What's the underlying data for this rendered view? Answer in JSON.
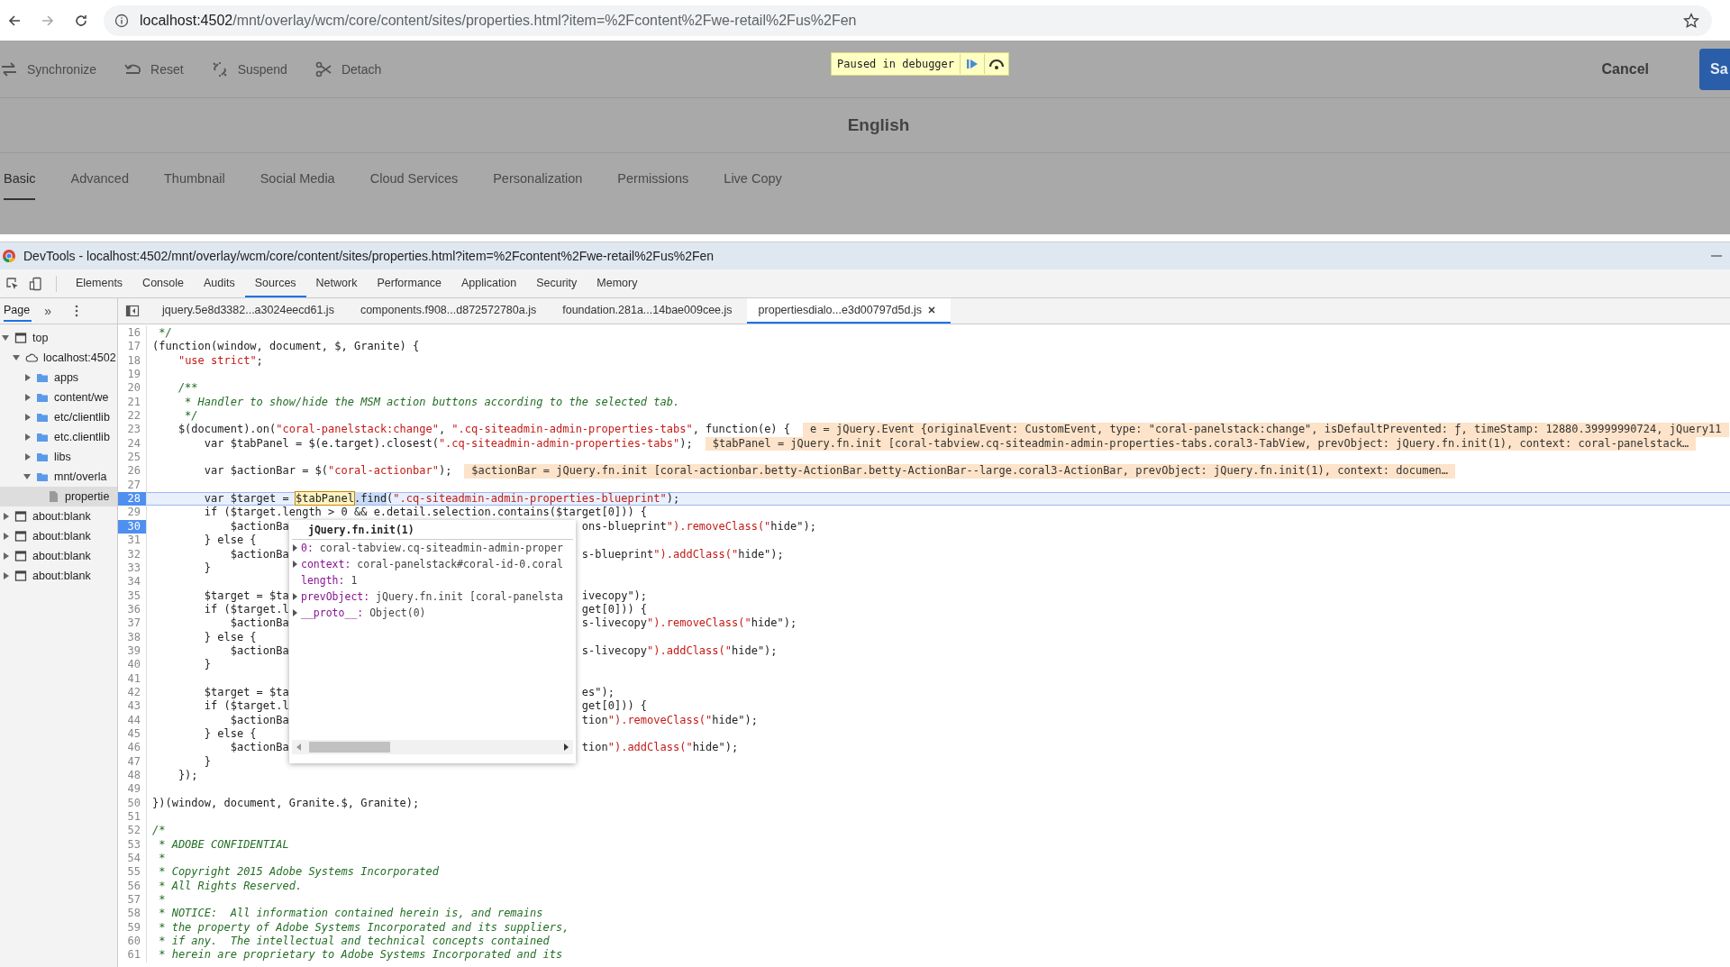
{
  "browser": {
    "url_host": "localhost:4502",
    "url_path": "/mnt/overlay/wcm/core/content/sites/properties.html?item=%2Fcontent%2Fwe-retail%2Fus%2Fen"
  },
  "aem": {
    "actions": [
      {
        "label": "Synchronize",
        "kind": "sync"
      },
      {
        "label": "Reset",
        "kind": "reset"
      },
      {
        "label": "Suspend",
        "kind": "suspend"
      },
      {
        "label": "Detach",
        "kind": "detach"
      }
    ],
    "paused_label": "Paused in debugger",
    "cancel": "Cancel",
    "save": "Sa",
    "title": "English",
    "tabs": [
      {
        "label": "Basic",
        "selected": true
      },
      {
        "label": "Advanced",
        "selected": false
      },
      {
        "label": "Thumbnail",
        "selected": false
      },
      {
        "label": "Social Media",
        "selected": false
      },
      {
        "label": "Cloud Services",
        "selected": false
      },
      {
        "label": "Personalization",
        "selected": false
      },
      {
        "label": "Permissions",
        "selected": false
      },
      {
        "label": "Live Copy",
        "selected": false
      }
    ]
  },
  "devtools": {
    "title": "DevTools - localhost:4502/mnt/overlay/wcm/core/content/sites/properties.html?item=%2Fcontent%2Fwe-retail%2Fus%2Fen",
    "panels": [
      {
        "label": "Elements",
        "selected": false
      },
      {
        "label": "Console",
        "selected": false
      },
      {
        "label": "Audits",
        "selected": false
      },
      {
        "label": "Sources",
        "selected": true
      },
      {
        "label": "Network",
        "selected": false
      },
      {
        "label": "Performance",
        "selected": false
      },
      {
        "label": "Application",
        "selected": false
      },
      {
        "label": "Security",
        "selected": false
      },
      {
        "label": "Memory",
        "selected": false
      }
    ],
    "navigator_tab": "Page",
    "more": "»",
    "files": [
      {
        "label": "jquery.5e8d3382...a3024eecd61.js",
        "selected": false
      },
      {
        "label": "components.f908...d872572780a.js",
        "selected": false
      },
      {
        "label": "foundation.281a...14bae009cee.js",
        "selected": false
      },
      {
        "label": "propertiesdialo...e3d00797d5d.js",
        "selected": true
      }
    ],
    "tree": [
      {
        "label": "top",
        "kind": "frame",
        "expanded": true,
        "children": [
          {
            "label": "localhost:4502",
            "kind": "origin",
            "expanded": true,
            "children": [
              {
                "label": "apps",
                "kind": "folder",
                "expanded": false
              },
              {
                "label": "content/we",
                "kind": "folder",
                "expanded": false
              },
              {
                "label": "etc/clientlib",
                "kind": "folder",
                "expanded": false
              },
              {
                "label": "etc.clientlib",
                "kind": "folder",
                "expanded": false
              },
              {
                "label": "libs",
                "kind": "folder",
                "expanded": false
              },
              {
                "label": "mnt/overla",
                "kind": "folder",
                "expanded": true,
                "children": [
                  {
                    "label": "propertie",
                    "kind": "file",
                    "selected": true
                  }
                ]
              }
            ]
          }
        ]
      },
      {
        "label": "about:blank",
        "kind": "frame",
        "expanded": false
      },
      {
        "label": "about:blank",
        "kind": "frame",
        "expanded": false
      },
      {
        "label": "about:blank",
        "kind": "frame",
        "expanded": false
      },
      {
        "label": "about:blank",
        "kind": "frame",
        "expanded": false
      }
    ],
    "lines": [
      {
        "n": "16",
        "kind": "comment",
        "parts": [
          {
            "text": " */"
          }
        ]
      },
      {
        "n": "17",
        "parts": [
          {
            "text": "(function(window, document, $, Granite) {"
          }
        ]
      },
      {
        "n": "18",
        "parts": [
          {
            "text": "    \"use strict\";"
          }
        ]
      },
      {
        "n": "19"
      },
      {
        "n": "20",
        "kind": "comment",
        "parts": [
          {
            "text": "    /**"
          }
        ]
      },
      {
        "n": "21",
        "kind": "comment",
        "parts": [
          {
            "text": "     * Handler to show/hide the MSM action buttons according to the selected tab."
          }
        ]
      },
      {
        "n": "22",
        "kind": "comment",
        "parts": [
          {
            "text": "     */"
          }
        ]
      },
      {
        "n": "23",
        "parts": [
          {
            "text": "    $(document).on(\"coral-panelstack:change\", \".cq-siteadmin-admin-properties-tabs\", function(e) {"
          }
        ],
        "inline": "e = jQuery.Event {originalEvent: CustomEvent, type: \"coral-panelstack:change\", isDefaultPrevented: ƒ, timeStamp: 12880.39999990724, jQuery11"
      },
      {
        "n": "24",
        "parts": [
          {
            "text": "        var $tabPanel = $(e.target).closest(\".cq-siteadmin-admin-properties-tabs\");"
          }
        ],
        "inline": "$tabPanel = jQuery.fn.init [coral-tabview.cq-siteadmin-admin-properties-tabs.coral3-TabView, prevObject: jQuery.fn.init(1), context: coral-panelstack…"
      },
      {
        "n": "25"
      },
      {
        "n": "26",
        "parts": [
          {
            "text": "        var $actionBar = $(\"coral-actionbar\");"
          }
        ],
        "inline": "$actionBar = jQuery.fn.init [coral-actionbar.betty-ActionBar.betty-ActionBar--large.coral3-ActionBar, prevObject: jQuery.fn.init(1), context: documen…"
      },
      {
        "n": "27"
      },
      {
        "n": "28",
        "breakpoint": true,
        "current": true,
        "parts": [
          {
            "text": "        var $target = "
          },
          {
            "text": "$tabPanel",
            "kind": "hover"
          },
          {
            "text": ".find",
            "kind": "selection"
          },
          {
            "text": "(\".cq-siteadmin-admin-properties-blueprint\");"
          }
        ]
      },
      {
        "n": "29",
        "parts": [
          {
            "text": "        if ($target.length > 0 && e.detail.selection.contains($target[0])) {"
          }
        ]
      },
      {
        "n": "30",
        "breakpoint": true,
        "parts": [
          {
            "text": "            $actionBa"
          }
        ],
        "after": "ons-blueprint\").removeClass(\"hide\");"
      },
      {
        "n": "31",
        "parts": [
          {
            "text": "        } else {"
          }
        ]
      },
      {
        "n": "32",
        "parts": [
          {
            "text": "            $actionBa"
          }
        ],
        "after": "s-blueprint\").addClass(\"hide\");"
      },
      {
        "n": "33",
        "parts": [
          {
            "text": "        }"
          }
        ]
      },
      {
        "n": "34"
      },
      {
        "n": "35",
        "parts": [
          {
            "text": "        $target = $ta"
          }
        ],
        "after": "ivecopy\");"
      },
      {
        "n": "36",
        "parts": [
          {
            "text": "        if ($target.l"
          }
        ],
        "after": "get[0])) {"
      },
      {
        "n": "37",
        "parts": [
          {
            "text": "            $actionBa"
          }
        ],
        "after": "s-livecopy\").removeClass(\"hide\");"
      },
      {
        "n": "38",
        "parts": [
          {
            "text": "        } else {"
          }
        ]
      },
      {
        "n": "39",
        "parts": [
          {
            "text": "            $actionBa"
          }
        ],
        "after": "s-livecopy\").addClass(\"hide\");"
      },
      {
        "n": "40",
        "parts": [
          {
            "text": "        }"
          }
        ]
      },
      {
        "n": "41"
      },
      {
        "n": "42",
        "parts": [
          {
            "text": "        $target = $ta"
          }
        ],
        "after": "es\");"
      },
      {
        "n": "43",
        "parts": [
          {
            "text": "        if ($target.l"
          }
        ],
        "after": "get[0])) {"
      },
      {
        "n": "44",
        "parts": [
          {
            "text": "            $actionBa"
          }
        ],
        "after": "tion\").removeClass(\"hide\");"
      },
      {
        "n": "45",
        "parts": [
          {
            "text": "        } else {"
          }
        ]
      },
      {
        "n": "46",
        "parts": [
          {
            "text": "            $actionBa"
          }
        ],
        "after": "tion\").addClass(\"hide\");"
      },
      {
        "n": "47",
        "parts": [
          {
            "text": "        }"
          }
        ]
      },
      {
        "n": "48",
        "parts": [
          {
            "text": "    });"
          }
        ]
      },
      {
        "n": "49"
      },
      {
        "n": "50",
        "parts": [
          {
            "text": "})(window, document, Granite.$, Granite);"
          }
        ]
      },
      {
        "n": "51"
      },
      {
        "n": "52",
        "kind": "comment",
        "parts": [
          {
            "text": "/*"
          }
        ]
      },
      {
        "n": "53",
        "kind": "comment",
        "parts": [
          {
            "text": " * ADOBE CONFIDENTIAL"
          }
        ]
      },
      {
        "n": "54",
        "kind": "comment",
        "parts": [
          {
            "text": " *"
          }
        ]
      },
      {
        "n": "55",
        "kind": "comment",
        "parts": [
          {
            "text": " * Copyright 2015 Adobe Systems Incorporated"
          }
        ]
      },
      {
        "n": "56",
        "kind": "comment",
        "parts": [
          {
            "text": " * All Rights Reserved."
          }
        ]
      },
      {
        "n": "57",
        "kind": "comment",
        "parts": [
          {
            "text": " *"
          }
        ]
      },
      {
        "n": "58",
        "kind": "comment",
        "parts": [
          {
            "text": " * NOTICE:  All information contained herein is, and remains"
          }
        ]
      },
      {
        "n": "59",
        "kind": "comment",
        "parts": [
          {
            "text": " * the property of Adobe Systems Incorporated and its suppliers,"
          }
        ]
      },
      {
        "n": "60",
        "kind": "comment",
        "parts": [
          {
            "text": " * if any.  The intellectual and technical concepts contained"
          }
        ]
      },
      {
        "n": "61",
        "kind": "comment",
        "parts": [
          {
            "text": " * herein are proprietary to Adobe Systems Incorporated and its"
          }
        ]
      }
    ],
    "popover": {
      "title": "jQuery.fn.init(1)",
      "rows": [
        {
          "key": "0:",
          "value": "coral-tabview.cq-siteadmin-admin-proper",
          "expandable": true
        },
        {
          "key": "context:",
          "value": "coral-panelstack#coral-id-0.coral",
          "expandable": true
        },
        {
          "key": "length:",
          "value": "1",
          "expandable": false
        },
        {
          "key": "prevObject:",
          "value": "jQuery.fn.init [coral-panelsta",
          "expandable": true
        },
        {
          "key": "__proto__:",
          "value": "Object(0)",
          "expandable": true
        }
      ]
    }
  }
}
